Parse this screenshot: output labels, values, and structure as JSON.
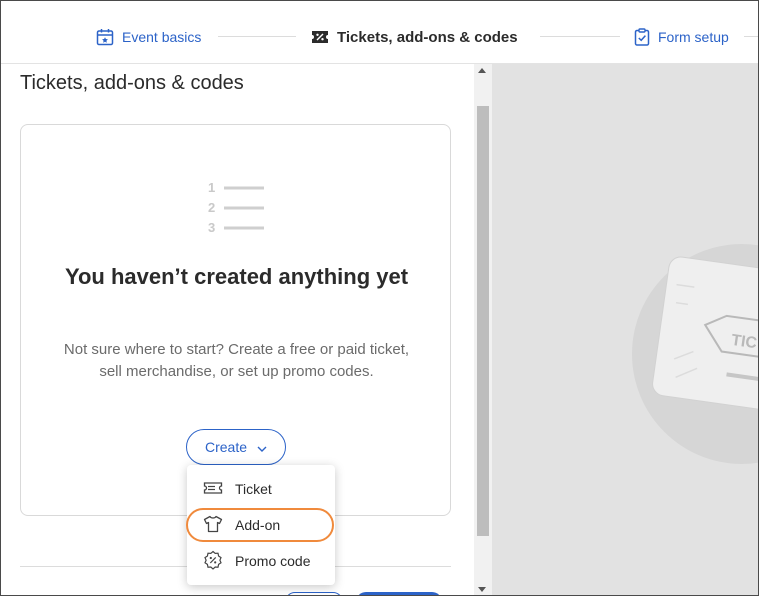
{
  "stepper": {
    "steps": [
      {
        "label": "Event basics",
        "state": "done",
        "icon": "calendar-icon"
      },
      {
        "label": "Tickets, add-ons & codes",
        "state": "current",
        "icon": "ticket-percent-icon"
      },
      {
        "label": "Form setup",
        "state": "todo",
        "icon": "clipboard-check-icon"
      }
    ]
  },
  "panel": {
    "title": "Tickets, add-ons & codes",
    "empty_state": {
      "heading": "You haven’t created anything yet",
      "description": "Not sure where to start? Create a free or paid ticket, sell merchandise, or set up promo codes.",
      "illustration_numbers": [
        "1",
        "2",
        "3"
      ]
    },
    "create_button": {
      "label": "Create"
    }
  },
  "menu": {
    "items": [
      {
        "label": "Ticket",
        "icon": "ticket-icon"
      },
      {
        "label": "Add-on",
        "icon": "tshirt-icon",
        "highlighted": true
      },
      {
        "label": "Promo code",
        "icon": "promo-badge-icon"
      }
    ]
  },
  "preview": {
    "ticket_text": "TIC"
  },
  "colors": {
    "accent": "#2c63c8",
    "highlight": "#f08a3c",
    "preview_bg": "#e2e2e2"
  }
}
